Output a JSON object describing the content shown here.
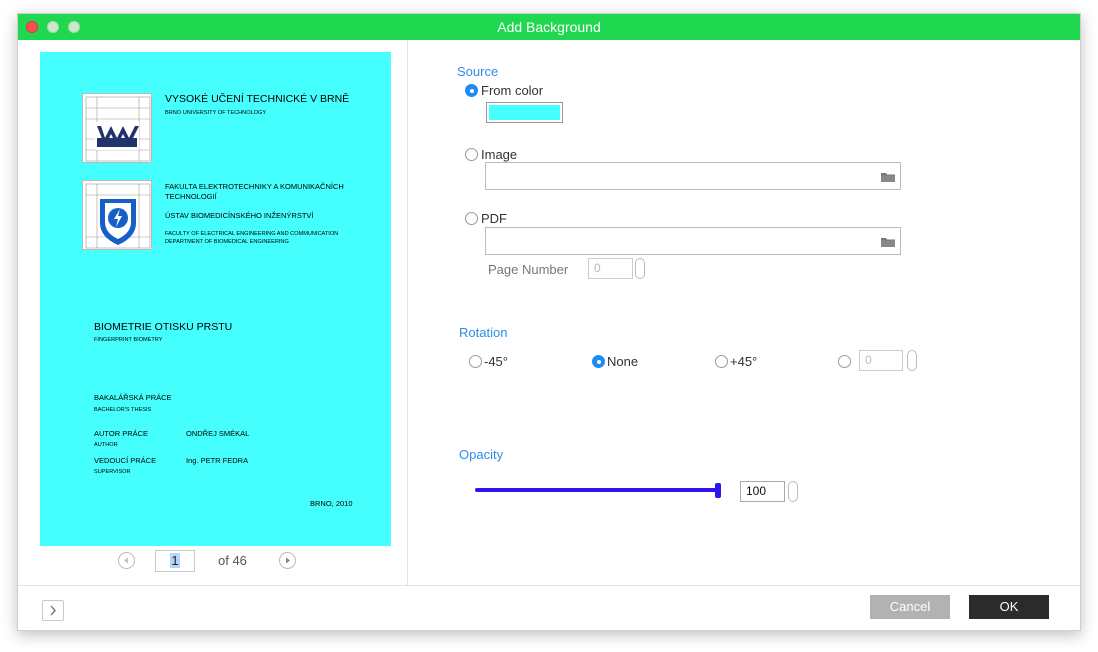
{
  "window": {
    "title": "Add Background"
  },
  "preview": {
    "background_color": "#44fffe",
    "document": {
      "university_name": "VYSOKÉ UČENÍ TECHNICKÉ V BRNĚ",
      "university_name_en": "BRNO UNIVERSITY OF TECHNOLOGY",
      "faculty_line1": "FAKULTA ELEKTROTECHNIKY A KOMUNIKAČNÍCH",
      "faculty_line2": "TECHNOLOGIÍ",
      "institute": "ÚSTAV BIOMEDICÍNSKÉHO INŽENÝRSTVÍ",
      "faculty_en": "FACULTY OF ELECTRICAL ENGINEERING AND COMMUNICATION",
      "department_en": "DEPARTMENT OF BIOMEDICAL ENGINEERING",
      "thesis_title": "BIOMETRIE OTISKU PRSTU",
      "thesis_title_en": "FINGERPRINT BIOMETRY",
      "thesis_type": "BAKALÁŘSKÁ PRÁCE",
      "thesis_type_en": "BACHELOR'S THESIS",
      "author_label": "AUTOR PRÁCE",
      "author_label_en": "AUTHOR",
      "author_name": "ONDŘEJ SMÉKAL",
      "supervisor_label": "VEDOUCÍ PRÁCE",
      "supervisor_label_en": "SUPERVISOR",
      "supervisor_name": "Ing. PETR FEDRA",
      "place_year": "BRNO, 2010"
    },
    "pager": {
      "current_page": "1",
      "total_label": "of 46"
    }
  },
  "source": {
    "title": "Source",
    "from_color_label": "From color",
    "color_value": "#44fffe",
    "image_label": "Image",
    "image_path": "",
    "pdf_label": "PDF",
    "pdf_path": "",
    "page_number_label": "Page Number",
    "page_number_value": "0",
    "selected": "From color"
  },
  "rotation": {
    "title": "Rotation",
    "options": [
      "-45°",
      "None",
      "+45°"
    ],
    "selected": "None",
    "custom_value": "0"
  },
  "opacity": {
    "title": "Opacity",
    "value": "100",
    "fraction": 1.0
  },
  "buttons": {
    "cancel": "Cancel",
    "ok": "OK"
  },
  "colors": {
    "titlebar": "#1fd84f",
    "accent": "#1d8cf5",
    "slider": "#2d15f0"
  }
}
